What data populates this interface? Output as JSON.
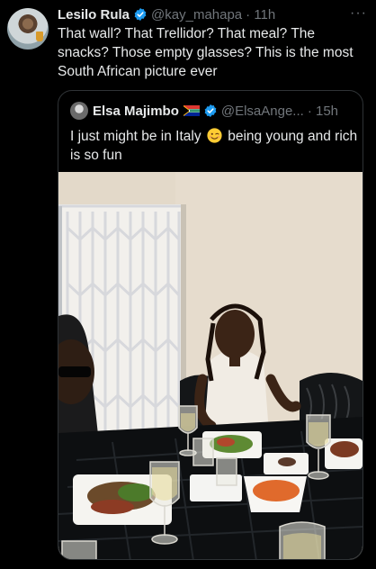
{
  "tweet": {
    "author_name": "Lesilo Rula",
    "author_handle": "@kay_mahapa",
    "time": "· 11h",
    "more_icon": "more-horizontal-icon",
    "text": "That wall? That Trellidor? That meal? The snacks? Those empty glasses? This is the most South African picture ever"
  },
  "quoted_tweet": {
    "author_name": "Elsa Majimbo",
    "flag_emoji": "south-africa-flag",
    "author_handle": "@ElsaAnge...",
    "time": "· 15h",
    "text_before_emoji": "I just might be in Italy",
    "emoji": "winking-face",
    "text_after_emoji": "being young and rich is so fun"
  },
  "colors": {
    "background": "#000000",
    "text_primary": "#e7e9ea",
    "text_secondary": "#71767b",
    "verified_blue": "#1d9bf0",
    "border": "#2f3336"
  }
}
